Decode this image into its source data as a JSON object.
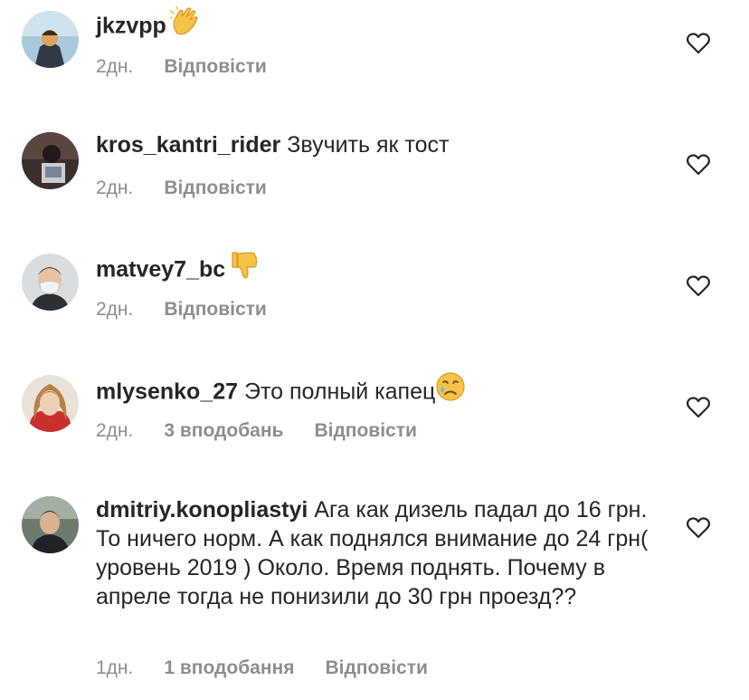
{
  "comments": [
    {
      "username": "jkzvpp",
      "text": "",
      "emoji": "clapping-hands-emoji",
      "time": "2дн.",
      "likes": "",
      "reply": "Відповісти"
    },
    {
      "username": "kros_kantri_rider",
      "text": "Звучить як тост",
      "emoji": "",
      "time": "2дн.",
      "likes": "",
      "reply": "Відповісти"
    },
    {
      "username": "matvey7_bc",
      "text": "",
      "emoji": "thumbs-down-emoji",
      "time": "2дн.",
      "likes": "",
      "reply": "Відповісти"
    },
    {
      "username": "mlysenko_27",
      "text": "Это полный капец",
      "emoji": "crying-face-emoji",
      "time": "2дн.",
      "likes": "3 вподобань",
      "reply": "Відповісти"
    },
    {
      "username": "dmitriy.konopliastyi",
      "text": "Ага как дизель падал до 16 грн. То ничего норм. А как поднялся внимание до 24 грн( уровень 2019 ) Около. Время поднять. Почему в апреле тогда не понизили до 30 грн проезд??",
      "emoji": "",
      "time": "1дн.",
      "likes": "1 вподобання",
      "reply": "Відповісти"
    }
  ],
  "colors": {
    "primary_text": "#262626",
    "secondary_text": "#8e8e8e",
    "background": "#ffffff"
  },
  "icons": {
    "like": "heart-outline-icon"
  }
}
